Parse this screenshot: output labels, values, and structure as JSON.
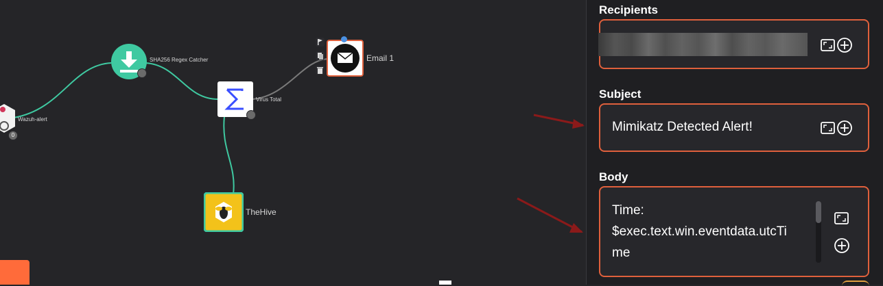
{
  "workflow": {
    "nodes": [
      {
        "id": "wazuh",
        "label": "Wazuh-alert",
        "badge": "0"
      },
      {
        "id": "sha256",
        "label": "SHA256 Regex Catcher"
      },
      {
        "id": "virustotal",
        "label": "Virus Total"
      },
      {
        "id": "email",
        "label": "Email 1"
      },
      {
        "id": "thehive",
        "label": "TheHive"
      }
    ]
  },
  "panel": {
    "recipients": {
      "title": "Recipients",
      "value": ""
    },
    "subject": {
      "title": "Subject",
      "value": "Mimikatz Detected Alert!"
    },
    "body": {
      "title": "Body",
      "lines": [
        "Time:",
        "$exec.text.win.eventdata.utcTi",
        "me"
      ]
    }
  },
  "colors": {
    "accent": "#e0603c",
    "edge": "#3fc9a1",
    "arrow": "#8b1a1a"
  }
}
